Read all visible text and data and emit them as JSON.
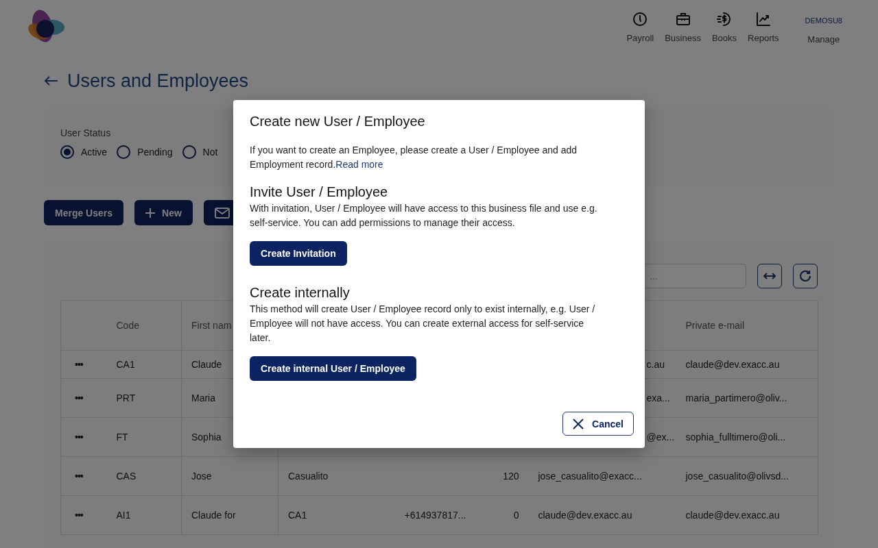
{
  "header": {
    "nav": [
      {
        "label": "Payroll"
      },
      {
        "label": "Business"
      },
      {
        "label": "Books"
      },
      {
        "label": "Reports"
      }
    ],
    "account": {
      "company": "DEMOSU8",
      "label": "Manage"
    }
  },
  "page_title": "Users and Employees",
  "filter": {
    "label": "User Status",
    "options": [
      {
        "label": "Active",
        "selected": true
      },
      {
        "label": "Pending",
        "selected": false
      },
      {
        "label": "Not",
        "selected": false
      }
    ]
  },
  "actions": [
    {
      "label": "Merge Users",
      "kind": "text"
    },
    {
      "label": "New",
      "kind": "plus"
    },
    {
      "kind": "mail"
    }
  ],
  "search": {
    "placeholder": "..."
  },
  "table": {
    "columns": [
      "",
      "Code",
      "First nam",
      "",
      "",
      "",
      "",
      "Private e-mail"
    ],
    "rows": [
      {
        "cells": [
          "•••",
          "CA1",
          "Claude",
          "",
          "",
          "",
          "c.au",
          "claude@dev.exacc.au"
        ]
      },
      {
        "cells": [
          "•••",
          "PRT",
          "Maria",
          "",
          "",
          "",
          "exa...",
          "maria_partimero@oliv..."
        ]
      },
      {
        "cells": [
          "•••",
          "FT",
          "Sophia",
          "",
          "",
          "",
          "@ex...",
          "sophia_fulltimero@oli..."
        ]
      },
      {
        "cells": [
          "•••",
          "CAS",
          "Jose",
          "Casualito",
          "",
          "120",
          "jose_casualito@exacc...",
          "jose_casualito@olivsd..."
        ]
      },
      {
        "cells": [
          "•••",
          "AI1",
          "Claude for",
          "CA1",
          "+614937817...",
          "0",
          "claude@dev.exacc.au",
          "claude@dev.exacc.au"
        ]
      }
    ]
  },
  "dialog": {
    "title": "Create new User / Employee",
    "intro": "If you want to create an Employee, please create a User / Employee and add Employment record.",
    "intro_link": "Read more",
    "sections": [
      {
        "heading": "Invite User / Employee",
        "text": "With invitation, User / Employee will have access to this business file and use e.g. self-service. You can add permissions to manage their access.",
        "button": "Create Invitation"
      },
      {
        "heading": "Create internally",
        "text": "This method will create User / Employee record only to exist internally, e.g. User / Employee will not have access. You can create external access for self-service later.",
        "button": "Create internal User / Employee"
      }
    ],
    "cancel": "Cancel"
  }
}
